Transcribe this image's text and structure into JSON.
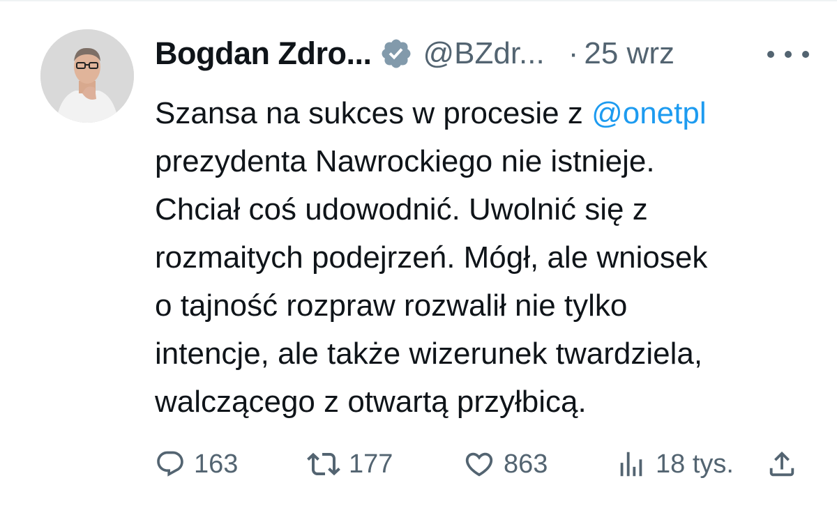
{
  "tweet": {
    "author_name": "Bogdan Zdro...",
    "handle": "@BZdr...",
    "separator": "·",
    "date": "25 wrz",
    "text_lines": [
      {
        "before": "Szansa na sukces w procesie z ",
        "mention": "@onetpl"
      },
      {
        "text": "prezydenta Nawrockiego nie istnieje."
      },
      {
        "text": "Chciał coś udowodnić. Uwolnić się z"
      },
      {
        "text": "rozmaitych podejrzeń. Mógł, ale wniosek"
      },
      {
        "text": "o tajność rozpraw rozwalił nie tylko"
      },
      {
        "text": "intencje, ale także wizerunek twardziela,"
      },
      {
        "text": "walczącego z otwartą przyłbicą."
      }
    ],
    "actions": {
      "replies": "163",
      "retweets": "177",
      "likes": "863",
      "views": "18 tys."
    }
  },
  "icons": {
    "verified": "verified-badge-icon",
    "more": "more-horizontal-icon",
    "reply": "reply-bubble-icon",
    "retweet": "retweet-icon",
    "like": "heart-icon",
    "views": "bar-chart-icon",
    "share": "share-upload-icon"
  },
  "colors": {
    "text": "#0f1419",
    "secondary": "#536471",
    "mention": "#1d9bf0",
    "verified_badge": "#829aab"
  }
}
